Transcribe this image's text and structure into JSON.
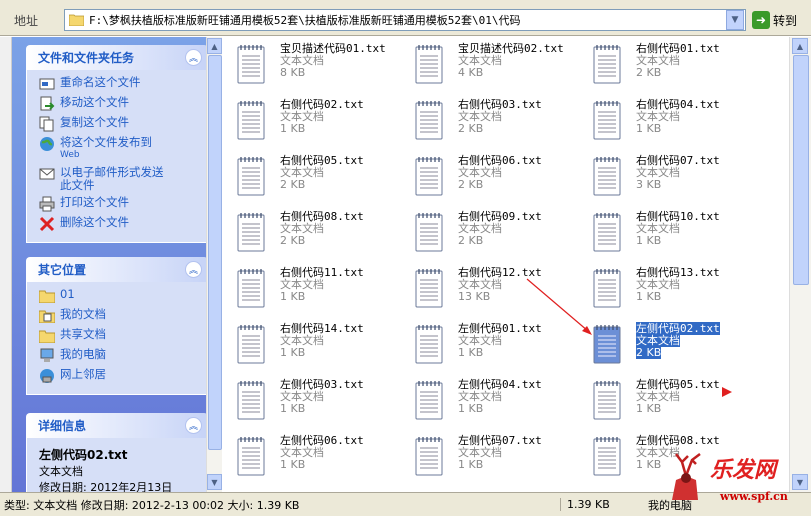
{
  "address": {
    "label": "地址",
    "path": "F:\\梦枫扶植版标准版新旺铺通用模板52套\\扶植版标准版新旺铺通用模板52套\\01\\代码",
    "go_label": "转到"
  },
  "file_tasks": {
    "title": "文件和文件夹任务",
    "items": [
      {
        "label": "重命名这个文件",
        "icon": "rename-icon"
      },
      {
        "label": "移动这个文件",
        "icon": "move-icon"
      },
      {
        "label": "复制这个文件",
        "icon": "copy-icon"
      },
      {
        "label": "将这个文件发布到",
        "sub": "Web",
        "icon": "globe-icon"
      },
      {
        "label": "以电子邮件形式发送",
        "sub2": "此文件",
        "icon": "email-icon"
      },
      {
        "label": "打印这个文件",
        "icon": "printer-icon"
      },
      {
        "label": "删除这个文件",
        "icon": "delete-icon"
      }
    ]
  },
  "other_places": {
    "title": "其它位置",
    "items": [
      {
        "label": "01",
        "icon": "folder-icon"
      },
      {
        "label": "我的文档",
        "icon": "documents-icon"
      },
      {
        "label": "共享文档",
        "icon": "folder-icon"
      },
      {
        "label": "我的电脑",
        "icon": "computer-icon"
      },
      {
        "label": "网上邻居",
        "icon": "network-icon"
      }
    ]
  },
  "details": {
    "title": "详细信息",
    "name": "左侧代码02.txt",
    "type": "文本文档",
    "modified": "修改日期: 2012年2月13日"
  },
  "files": [
    {
      "name": "宝贝描述代码01.txt",
      "type": "文本文档",
      "size": "8 KB"
    },
    {
      "name": "宝贝描述代码02.txt",
      "type": "文本文档",
      "size": "4 KB"
    },
    {
      "name": "右侧代码01.txt",
      "type": "文本文档",
      "size": "2 KB"
    },
    {
      "name": "右侧代码02.txt",
      "type": "文本文档",
      "size": "1 KB"
    },
    {
      "name": "右侧代码03.txt",
      "type": "文本文档",
      "size": "2 KB"
    },
    {
      "name": "右侧代码04.txt",
      "type": "文本文档",
      "size": "1 KB"
    },
    {
      "name": "右侧代码05.txt",
      "type": "文本文档",
      "size": "2 KB"
    },
    {
      "name": "右侧代码06.txt",
      "type": "文本文档",
      "size": "2 KB"
    },
    {
      "name": "右侧代码07.txt",
      "type": "文本文档",
      "size": "3 KB"
    },
    {
      "name": "右侧代码08.txt",
      "type": "文本文档",
      "size": "2 KB"
    },
    {
      "name": "右侧代码09.txt",
      "type": "文本文档",
      "size": "2 KB"
    },
    {
      "name": "右侧代码10.txt",
      "type": "文本文档",
      "size": "1 KB"
    },
    {
      "name": "右侧代码11.txt",
      "type": "文本文档",
      "size": "1 KB"
    },
    {
      "name": "右侧代码12.txt",
      "type": "文本文档",
      "size": "13 KB"
    },
    {
      "name": "右侧代码13.txt",
      "type": "文本文档",
      "size": "1 KB"
    },
    {
      "name": "右侧代码14.txt",
      "type": "文本文档",
      "size": "1 KB"
    },
    {
      "name": "左侧代码01.txt",
      "type": "文本文档",
      "size": "1 KB"
    },
    {
      "name": "左侧代码02.txt",
      "type": "文本文档",
      "size": "2 KB",
      "selected": true
    },
    {
      "name": "左侧代码03.txt",
      "type": "文本文档",
      "size": "1 KB"
    },
    {
      "name": "左侧代码04.txt",
      "type": "文本文档",
      "size": "1 KB"
    },
    {
      "name": "左侧代码05.txt",
      "type": "文本文档",
      "size": "1 KB"
    },
    {
      "name": "左侧代码06.txt",
      "type": "文本文档",
      "size": "1 KB"
    },
    {
      "name": "左侧代码07.txt",
      "type": "文本文档",
      "size": "1 KB"
    },
    {
      "name": "左侧代码08.txt",
      "type": "文本文档",
      "size": "1 KB"
    }
  ],
  "status": {
    "main": "类型: 文本文档 修改日期: 2012-2-13 00:02 大小: 1.39 KB",
    "size": "1.39 KB",
    "zone": "我的电脑"
  },
  "watermark": {
    "text": "乐发网",
    "url": "www.spf.cn"
  },
  "colors": {
    "taskpane_top": "#7ba2e7",
    "taskpane_bottom": "#6375d6",
    "link": "#215dc6",
    "selection": "#316ac5",
    "annotation_arrow": "#e02020"
  }
}
